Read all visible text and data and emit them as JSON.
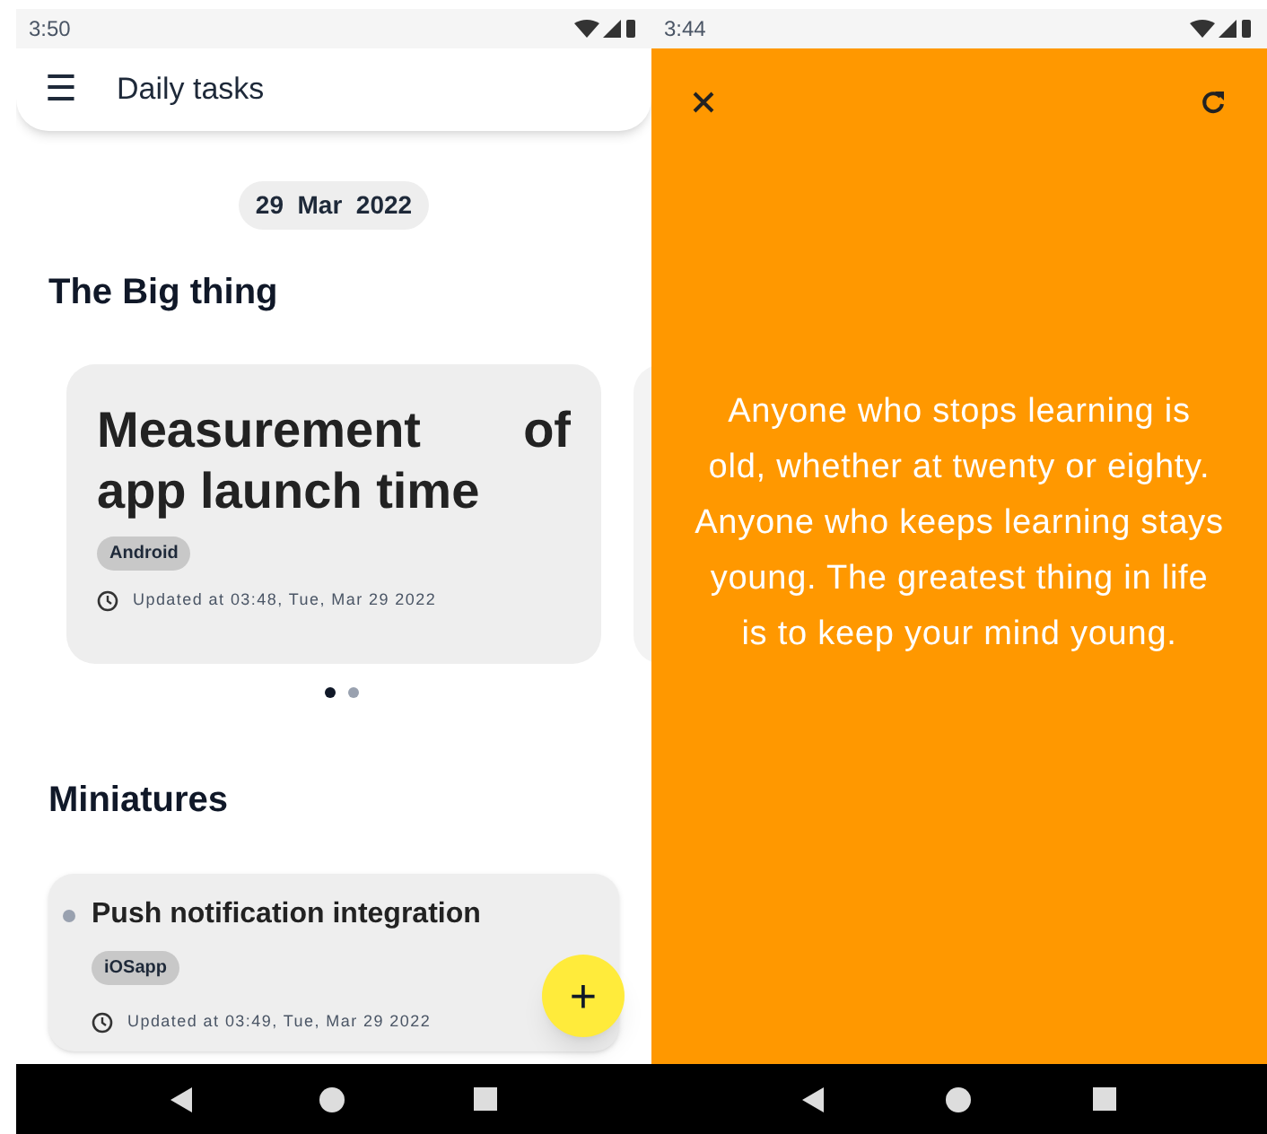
{
  "left_screen": {
    "status_bar": {
      "time": "3:50"
    },
    "app_bar": {
      "menu_icon": "☰",
      "title": "Daily tasks"
    },
    "date_chip": "29  Mar  2022",
    "big_thing": {
      "heading": "The Big thing",
      "card": {
        "title": "Measurement of app launch time",
        "tag": "Android",
        "updated": "Updated at 03:48, Tue, Mar 29 2022"
      },
      "pager": [
        {
          "selected": true
        },
        {
          "selected": false
        }
      ]
    },
    "miniatures": {
      "heading": "Miniatures",
      "items": [
        {
          "title": "Push notification integration",
          "tag": "iOSapp",
          "updated": "Updated at 03:49, Tue, Mar 29 2022"
        }
      ]
    },
    "fab": "+"
  },
  "right_screen": {
    "status_bar": {
      "time": "3:44"
    },
    "quote": "Anyone who stops learning is old, whether at twenty or eighty. Anyone who keeps learning stays young. The greatest thing in life is to keep your mind young."
  }
}
